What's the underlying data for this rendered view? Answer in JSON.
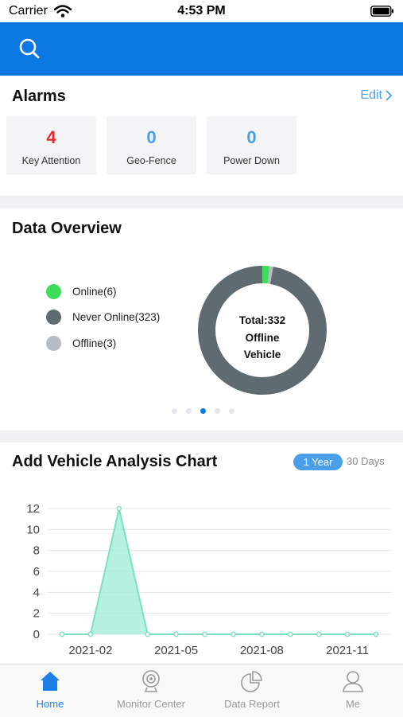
{
  "status_bar": {
    "carrier": "Carrier",
    "time": "4:53 PM"
  },
  "alarms": {
    "title": "Alarms",
    "edit_label": "Edit",
    "cards": [
      {
        "value": "4",
        "label": "Key Attention",
        "color": "#e8282f"
      },
      {
        "value": "0",
        "label": "Geo-Fence",
        "color": "#4a9fe8"
      },
      {
        "value": "0",
        "label": "Power Down",
        "color": "#4a9fe8"
      }
    ]
  },
  "data_overview": {
    "title": "Data Overview",
    "legend": [
      {
        "label": "Online(6)",
        "count": 6,
        "color": "#3ddc5a"
      },
      {
        "label": "Never Online(323)",
        "count": 323,
        "color": "#5f6a71"
      },
      {
        "label": "Offline(3)",
        "count": 3,
        "color": "#b6bcc4"
      }
    ],
    "center_lines": [
      "Total:332",
      "Offline",
      "Vehicle"
    ],
    "pager": {
      "count": 5,
      "active": 2
    }
  },
  "analysis": {
    "title": "Add Vehicle Analysis Chart",
    "range_options": [
      "1 Year",
      "30 Days"
    ],
    "active_range": "1 Year"
  },
  "chart_data": {
    "type": "area",
    "x": [
      "2021-01",
      "2021-02",
      "2021-03",
      "2021-04",
      "2021-05",
      "2021-06",
      "2021-07",
      "2021-08",
      "2021-09",
      "2021-10",
      "2021-11",
      "2021-12"
    ],
    "values": [
      0,
      0,
      12,
      0,
      0,
      0,
      0,
      0,
      0,
      0,
      0,
      0
    ],
    "x_tick_labels": [
      "2021-02",
      "2021-05",
      "2021-08",
      "2021-11"
    ],
    "y_ticks": [
      0,
      2,
      4,
      6,
      8,
      10,
      12
    ],
    "ylim": [
      0,
      12
    ],
    "grid": true,
    "line_color": "#7de0c3",
    "fill_color": "#9eecd6"
  },
  "tab_bar": {
    "tabs": [
      {
        "label": "Home",
        "icon": "home-icon",
        "active": true
      },
      {
        "label": "Monitor Center",
        "icon": "webcam-icon",
        "active": false
      },
      {
        "label": "Data Report",
        "icon": "pie-chart-icon",
        "active": false
      },
      {
        "label": "Me",
        "icon": "person-icon",
        "active": false
      }
    ]
  }
}
